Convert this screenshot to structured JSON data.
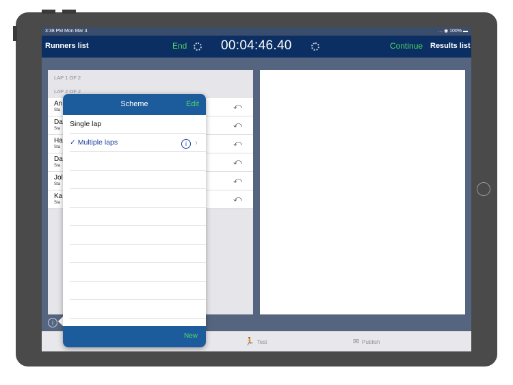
{
  "status_bar": {
    "time_date": "3:38 PM  Mon Mar 4",
    "right": "… ◉ 100% ▬"
  },
  "nav": {
    "left_title": "Runners list",
    "end_label": "End",
    "timer": "00:04:46.40",
    "continue_label": "Continue",
    "results_label": "Results list"
  },
  "laps": [
    "LAP 1 OF 2",
    "LAP 2 OF 2"
  ],
  "runners": [
    {
      "name": "An",
      "sub": "Sta"
    },
    {
      "name": "Da",
      "sub": "Sta"
    },
    {
      "name": "Ha",
      "sub": "Sta"
    },
    {
      "name": "Da",
      "sub": "Sta"
    },
    {
      "name": "Jol",
      "sub": "Sta"
    },
    {
      "name": "Ka",
      "sub": "Sta"
    }
  ],
  "popover": {
    "title": "Scheme",
    "edit_label": "Edit",
    "options": [
      "Single lap",
      "✓ Multiple laps"
    ],
    "selected_index": 1,
    "new_label": "New"
  },
  "tabs": [
    {
      "icon": "runner-icon",
      "glyph": "🏃",
      "label": "Test"
    },
    {
      "icon": "mail-icon",
      "glyph": "✉",
      "label": "Publish"
    }
  ],
  "icons": {
    "undo_glyph": "⤺",
    "info_glyph": "i",
    "chevron_glyph": "›"
  },
  "colors": {
    "nav_bg": "#0b2e63",
    "accent_green": "#4cd964",
    "popover_header": "#1d5c9c",
    "selected_blue": "#1d3f9c"
  }
}
